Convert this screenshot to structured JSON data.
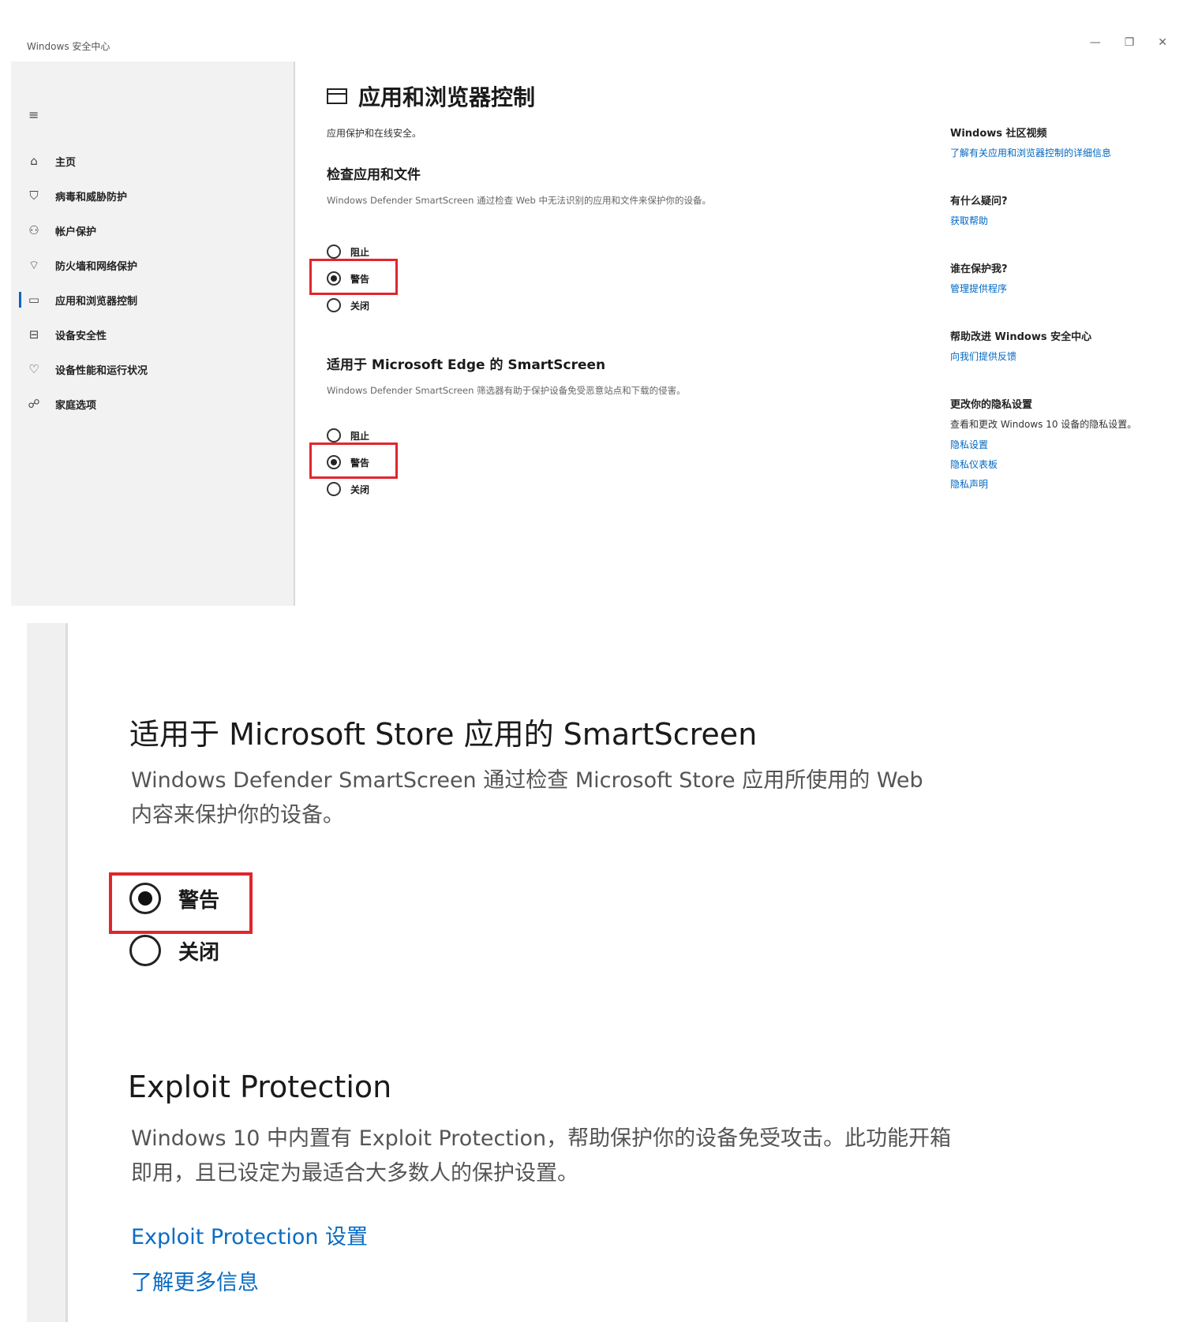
{
  "window": {
    "title": "Windows 安全中心",
    "controls": [
      "—",
      "❐",
      "✕"
    ]
  },
  "sidebar": {
    "menu_icon": "hamburger-icon",
    "items": [
      {
        "label": "主页",
        "icon": "home-icon",
        "glyph": "⌂"
      },
      {
        "label": "病毒和威胁防护",
        "icon": "shield-icon",
        "glyph": "⛉"
      },
      {
        "label": "帐户保护",
        "icon": "person-icon",
        "glyph": "⚇"
      },
      {
        "label": "防火墙和网络保护",
        "icon": "wifi-icon",
        "glyph": "⌔"
      },
      {
        "label": "应用和浏览器控制",
        "icon": "app-window-icon",
        "glyph": "▭",
        "active": true
      },
      {
        "label": "设备安全性",
        "icon": "laptop-icon",
        "glyph": "⊟"
      },
      {
        "label": "设备性能和运行状况",
        "icon": "heart-icon",
        "glyph": "♡"
      },
      {
        "label": "家庭选项",
        "icon": "family-icon",
        "glyph": "☍"
      }
    ]
  },
  "main": {
    "title": "应用和浏览器控制",
    "subtitle": "应用保护和在线安全。",
    "sections": [
      {
        "heading": "检查应用和文件",
        "description": "Windows Defender SmartScreen 通过检查 Web 中无法识别的应用和文件来保护你的设备。",
        "options": [
          "阻止",
          "警告",
          "关闭"
        ],
        "selected": "警告"
      },
      {
        "heading": "适用于 Microsoft Edge 的 SmartScreen",
        "description": "Windows Defender SmartScreen 筛选器有助于保护设备免受恶意站点和下载的侵害。",
        "options": [
          "阻止",
          "警告",
          "关闭"
        ],
        "selected": "警告"
      }
    ]
  },
  "aside": {
    "groups": [
      {
        "heading": "Windows 社区视频",
        "links": [
          "了解有关应用和浏览器控制的详细信息"
        ]
      },
      {
        "heading": "有什么疑问?",
        "links": [
          "获取帮助"
        ]
      },
      {
        "heading": "谁在保护我?",
        "links": [
          "管理提供程序"
        ]
      },
      {
        "heading": "帮助改进 Windows 安全中心",
        "links": [
          "向我们提供反馈"
        ]
      },
      {
        "heading": "更改你的隐私设置",
        "text": "查看和更改 Windows 10 设备的隐私设置。",
        "links": [
          "隐私设置",
          "隐私仪表板",
          "隐私声明"
        ]
      }
    ]
  },
  "zoom": {
    "store_heading": "适用于 Microsoft Store 应用的 SmartScreen",
    "store_description": "Windows Defender SmartScreen 通过检查 Microsoft Store 应用所使用的 Web 内容来保护你的设备。",
    "store_options": [
      "警告",
      "关闭"
    ],
    "store_selected": "警告",
    "exploit_heading": "Exploit Protection",
    "exploit_description": "Windows 10 中内置有 Exploit Protection，帮助保护你的设备免受攻击。此功能开箱即用，且已设定为最适合大多数人的保护设置。",
    "exploit_link_settings": "Exploit Protection 设置",
    "exploit_link_more": "了解更多信息"
  },
  "colors": {
    "accent": "#0067c0",
    "highlight": "#e0262d"
  }
}
